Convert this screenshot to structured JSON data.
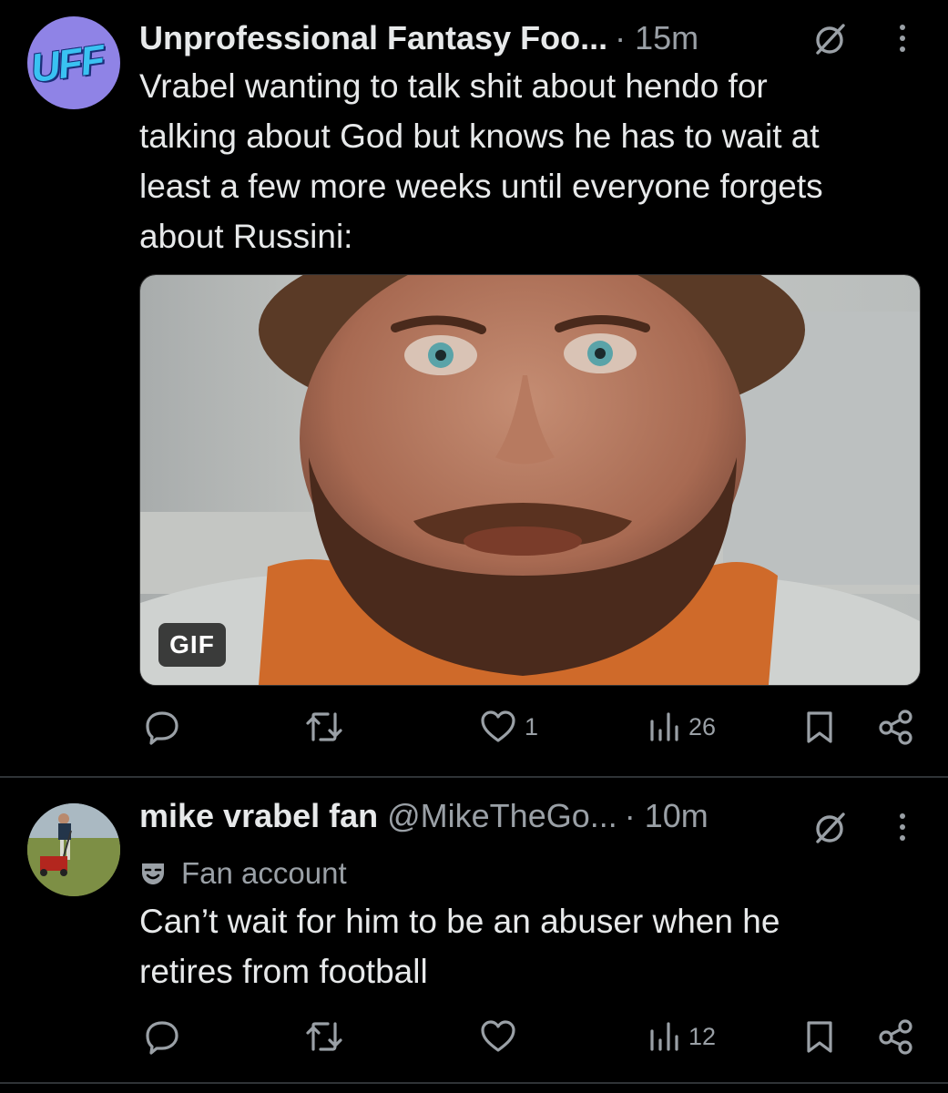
{
  "posts": [
    {
      "author_name": "Unprofessional Fantasy Foo...",
      "time": "· 15m",
      "avatar_text": "UFF",
      "text_lines": [
        "Vrabel wanting to talk shit about hendo for",
        "talking about God but knows he has to wait at",
        "least a few more weeks until everyone forgets",
        "about Russini:"
      ],
      "media_badge": "GIF",
      "actions": {
        "reply": "",
        "repost": "",
        "like": "1",
        "views": "26"
      }
    },
    {
      "author_name": "mike vrabel fan",
      "handle": "@MikeTheGo...",
      "time": "· 10m",
      "badge_label": "Fan account",
      "text_lines": [
        "Can’t wait for him to be an abuser when he",
        "retires from football"
      ],
      "actions": {
        "reply": "",
        "repost": "",
        "like": "",
        "views": "12"
      }
    }
  ],
  "colors": {
    "background": "#000000",
    "text": "#e7e9ea",
    "muted": "#9aa0a6",
    "avatar_uff": "#8f83e6"
  },
  "icons": [
    "reply-icon",
    "repost-icon",
    "like-icon",
    "views-icon",
    "bookmark-icon",
    "share-icon",
    "grok-icon",
    "more-icon",
    "theater-mask-icon"
  ]
}
